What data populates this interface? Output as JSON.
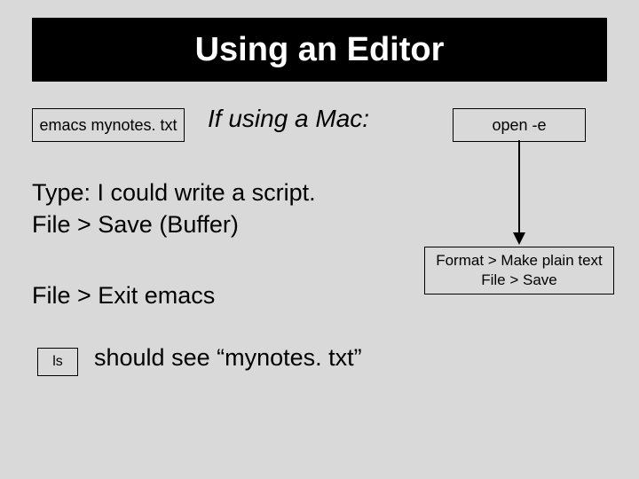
{
  "title": "Using an Editor",
  "emacs_cmd": "emacs   mynotes. txt",
  "mac_label": "If using a Mac:",
  "open_cmd": "open  -e",
  "line_type": "Type:  I could write a script.",
  "line_save": "File > Save (Buffer)",
  "line_exit": "File > Exit emacs",
  "ls_cmd": "ls",
  "ls_result": "should see  “mynotes. txt”",
  "format_line1": "Format > Make plain text",
  "format_line2": "File > Save"
}
